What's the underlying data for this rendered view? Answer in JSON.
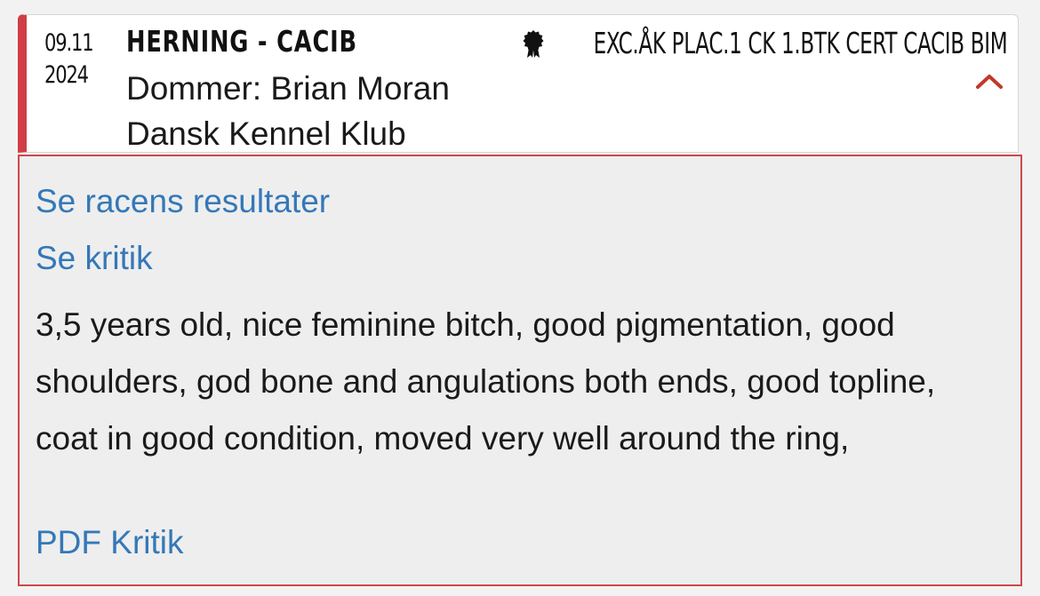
{
  "entry": {
    "date_day_month": "09.11",
    "date_year": "2024",
    "show_title": "HERNING - CACIB",
    "judge": "Dommer: Brian Moran",
    "club": "Dansk Kennel Klub",
    "result": "EXC.ÅK PLAC.1 CK 1.BTK CERT CACIB BIM",
    "result_icon": "rosette-icon",
    "expand_icon": "chevron-up-icon",
    "accent_color": "#d13d46"
  },
  "details": {
    "breed_results_link": "Se racens resultater",
    "critique_link": "Se kritik",
    "critique_text": "3,5 years old, nice feminine bitch, good pigmentation, good shoulders, god bone and angulations both ends, good topline, coat in good condition, moved very well around the ring,",
    "pdf_link": "PDF Kritik",
    "link_color": "#3478b8",
    "border_color": "#d0474d"
  }
}
